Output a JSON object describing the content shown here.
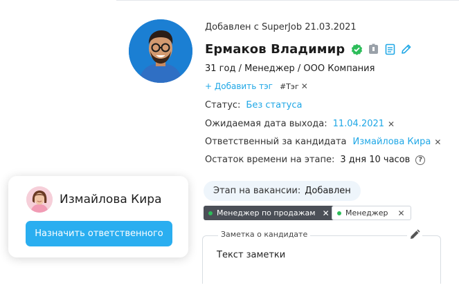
{
  "candidate": {
    "source": "Добавлен с SuperJob 21.03.2021",
    "name": "Ермаков Владимир",
    "summary": "31 год / Менеджер / ООО Компания",
    "add_tag": "+ Добавить тэг",
    "tag": "#Тэг",
    "status_label": "Статус:",
    "status_value": "Без статуса",
    "exit_date_label": "Ожидаемая дата выхода:",
    "exit_date_value": "11.04.2021",
    "responsible_label": "Ответственный за кандидата",
    "responsible_value": "Измайлова Кира",
    "time_left_label": "Остаток времени на этапе:",
    "time_left_value": "3 дня 10 часов",
    "help_glyph": "?",
    "remove_glyph": "✕"
  },
  "stage": {
    "label": "Этап на вакансии:",
    "value": "Добавлен"
  },
  "vacancies": [
    {
      "label": "Менеджер по продажам",
      "style": "dark"
    },
    {
      "label": "Менеджер",
      "style": "light"
    }
  ],
  "note": {
    "label": "Заметка о кандидате",
    "text": "Текст заметки"
  },
  "assign_card": {
    "name": "Измайлова Кира",
    "button": "Назначить ответственного"
  },
  "icons": {
    "verified": "verified-check-icon",
    "archive": "archive-icon",
    "resume": "document-icon",
    "edit": "pencil-icon"
  },
  "colors": {
    "link": "#1fa7e6",
    "button": "#2aaef0",
    "verified": "#2dbd5a",
    "status_dot": "#2dbd5a",
    "dark_chip": "#4b4f57",
    "stage_bg": "#eef5fb"
  }
}
